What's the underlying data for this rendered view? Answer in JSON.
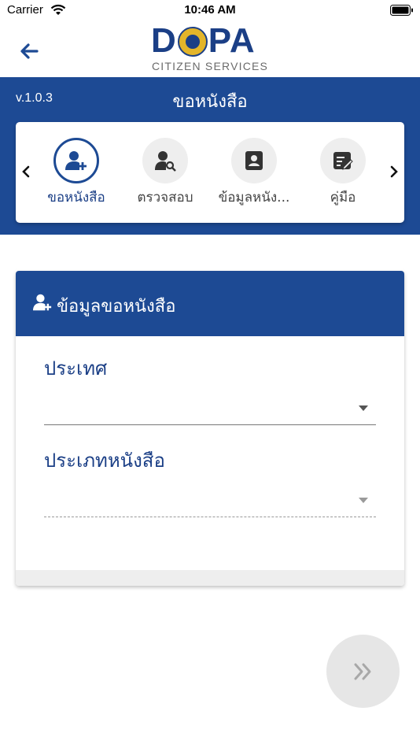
{
  "status_bar": {
    "carrier": "Carrier",
    "time": "10:46 AM"
  },
  "header": {
    "back_icon": "arrow-left-icon",
    "logo": {
      "word_left": "D",
      "word_right": "PA",
      "subtitle": "CITIZEN SERVICES"
    }
  },
  "banner": {
    "version": "v.1.0.3",
    "title": "ขอหนังสือ"
  },
  "tabs": [
    {
      "label": "ขอหนังสือ",
      "icon": "user-add-icon",
      "active": true
    },
    {
      "label": "ตรวจสอบ",
      "icon": "user-search-icon",
      "active": false
    },
    {
      "label": "ข้อมูลหนัง...",
      "icon": "contact-card-icon",
      "active": false
    },
    {
      "label": "คู่มือ",
      "icon": "edit-note-icon",
      "active": false
    }
  ],
  "form": {
    "title": "ข้อมูลขอหนังสือ",
    "fields": [
      {
        "label": "ประเทศ",
        "value": ""
      },
      {
        "label": "ประเภทหนังสือ",
        "value": ""
      }
    ]
  },
  "next_button": {
    "icon": "double-chevron-right-icon"
  },
  "colors": {
    "primary": "#1d4a94",
    "accent_gold": "#e3b52a",
    "fab_bg": "#e6e6e6"
  }
}
